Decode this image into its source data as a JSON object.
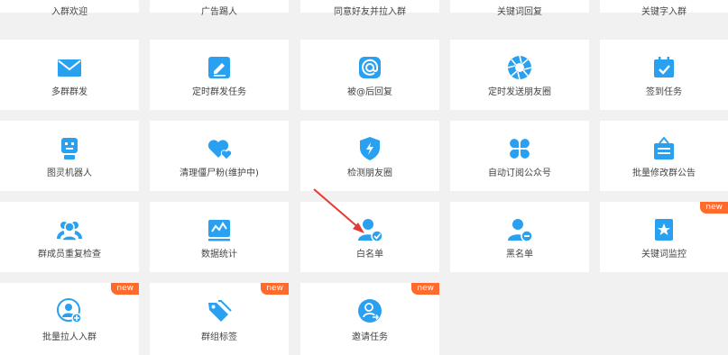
{
  "colors": {
    "accent": "#2aa0f0",
    "badge": "#ff6b2c"
  },
  "rows": {
    "r0": [
      {
        "label": "入群欢迎"
      },
      {
        "label": "广告踢人"
      },
      {
        "label": "同意好友并拉入群"
      },
      {
        "label": "关键词回复"
      },
      {
        "label": "关键字入群"
      }
    ],
    "r1": [
      {
        "label": "多群群发",
        "icon": "mail-icon"
      },
      {
        "label": "定时群发任务",
        "icon": "edit-icon"
      },
      {
        "label": "被@后回复",
        "icon": "at-icon"
      },
      {
        "label": "定时发送朋友圈",
        "icon": "shutter-icon"
      },
      {
        "label": "签到任务",
        "icon": "calendar-check-icon"
      }
    ],
    "r2": [
      {
        "label": "图灵机器人",
        "icon": "robot-icon"
      },
      {
        "label": "清理僵尸粉(维护中)",
        "icon": "heart-icon"
      },
      {
        "label": "检测朋友圈",
        "icon": "shield-bolt-icon"
      },
      {
        "label": "自动订阅公众号",
        "icon": "clover-icon"
      },
      {
        "label": "批量修改群公告",
        "icon": "notice-board-icon"
      }
    ],
    "r3": [
      {
        "label": "群成员重复检查",
        "icon": "group-icon"
      },
      {
        "label": "数据统计",
        "icon": "chart-icon"
      },
      {
        "label": "白名单",
        "icon": "user-check-icon"
      },
      {
        "label": "黑名单",
        "icon": "user-remove-icon"
      },
      {
        "label": "关键词监控",
        "icon": "star-bookmark-icon",
        "badge": "new"
      }
    ],
    "r4": [
      {
        "label": "批量拉人入群",
        "icon": "user-add-icon",
        "badge": "new"
      },
      {
        "label": "群组标签",
        "icon": "tag-icon",
        "badge": "new"
      },
      {
        "label": "邀请任务",
        "icon": "invite-icon",
        "badge": "new"
      }
    ]
  }
}
